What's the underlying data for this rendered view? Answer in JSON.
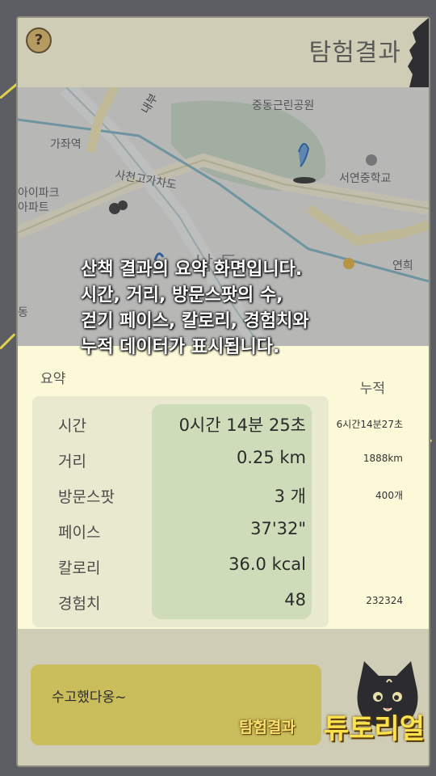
{
  "header": {
    "title": "탐험결과",
    "help_icon": "?"
  },
  "map": {
    "labels": {
      "park": "중동근린공원",
      "gajwa": "가좌역",
      "road": "사천고가차도",
      "apt1": "아이파크",
      "apt2": "아파트",
      "school": "서연중학교",
      "dong": "남 동",
      "right_label": "연희",
      "left_label": "동",
      "top_road": "내부"
    }
  },
  "tutorial": {
    "lines": [
      "산책 결과의 요약 화면입니다.",
      "시간, 거리, 방문스팟의 수,",
      "걷기 페이스, 칼로리, 경험치와",
      "누적 데이터가 표시됩니다."
    ],
    "badge_small": "탐험결과",
    "badge_big": "튜토리얼"
  },
  "summary": {
    "tab_label": "요약",
    "cumulative_label": "누적",
    "rows": [
      {
        "label": "시간",
        "value": "0시간 14분 25초",
        "cumulative": "6시간14분27초"
      },
      {
        "label": "거리",
        "value": "0.25 km",
        "cumulative": "1888km"
      },
      {
        "label": "방문스팟",
        "value": "3 개",
        "cumulative": "400개"
      },
      {
        "label": "페이스",
        "value": "37'32\"",
        "cumulative": ""
      },
      {
        "label": "칼로리",
        "value": "36.0 kcal",
        "cumulative": ""
      },
      {
        "label": "경험치",
        "value": "48",
        "cumulative": "232324"
      }
    ]
  },
  "bottom": {
    "message": "수고했다옹~"
  },
  "colors": {
    "background": "#5d5e63",
    "panel": "#fcf9d9",
    "accent": "#c9bd5c",
    "tutorial_text": "#fbe24d"
  }
}
